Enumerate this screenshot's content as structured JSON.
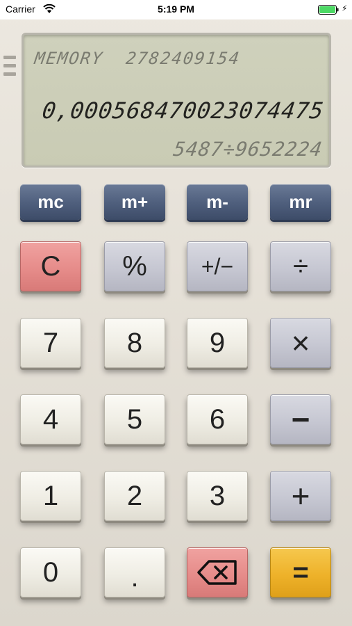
{
  "status_bar": {
    "carrier": "Carrier",
    "time": "5:19 PM",
    "battery_color": "#4cd964"
  },
  "display": {
    "memory_label": "MEMORY",
    "memory_value": "2782409154",
    "main_value": "0,000568470023074475",
    "expression": "5487÷9652224"
  },
  "memory_keys": {
    "mc": "mc",
    "m_plus": "m+",
    "m_minus": "m-",
    "mr": "mr"
  },
  "keys": {
    "clear": "C",
    "percent": "%",
    "sign": "+/−",
    "divide": "÷",
    "seven": "7",
    "eight": "8",
    "nine": "9",
    "multiply": "×",
    "four": "4",
    "five": "5",
    "six": "6",
    "minus": "−",
    "one": "1",
    "two": "2",
    "three": "3",
    "plus": "+",
    "zero": "0",
    "decimal": ".",
    "backspace_icon": "backspace-icon",
    "equals": "="
  },
  "colors": {
    "memory_key": "#4e5e7c",
    "clear_key": "#e68c8a",
    "equals_key": "#eeb22a",
    "operator_key": "#c6c7d2",
    "lcd": "#cfd1bc"
  }
}
